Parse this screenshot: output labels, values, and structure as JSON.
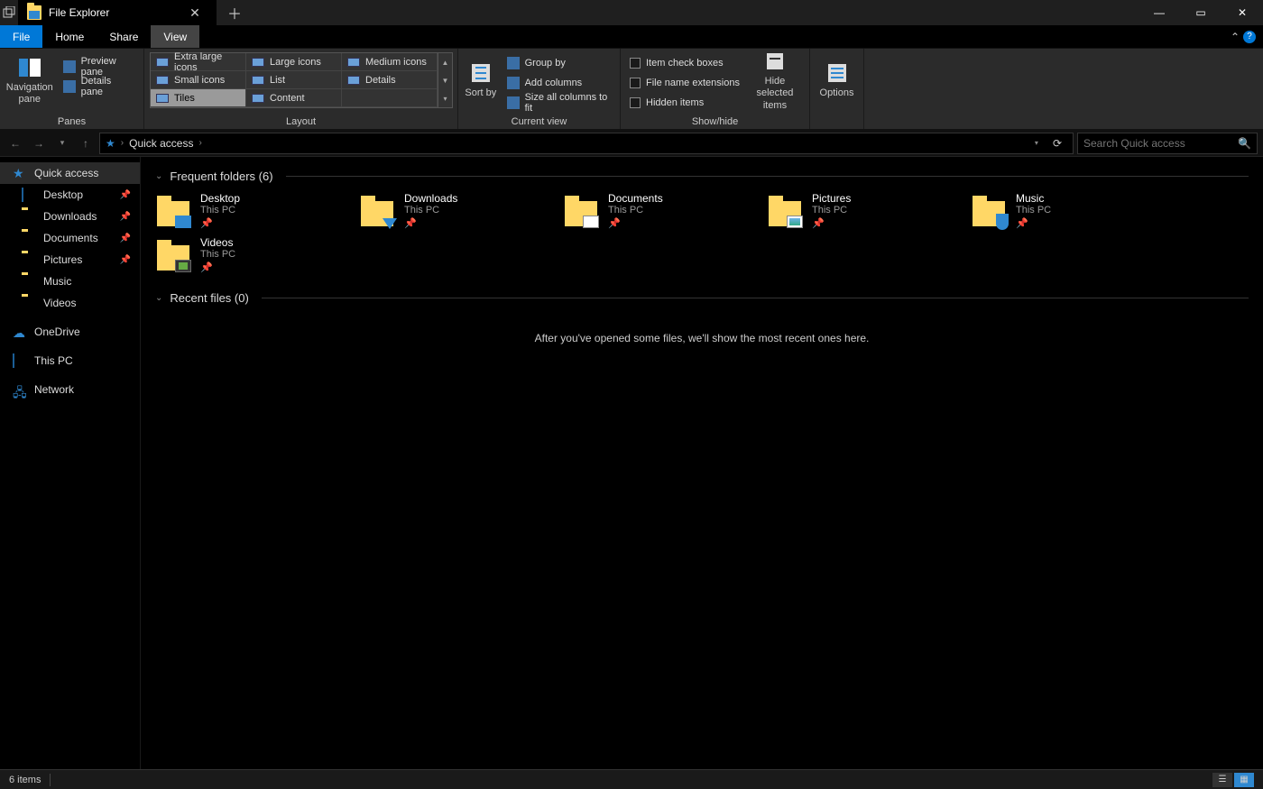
{
  "titlebar": {
    "tab_title": "File Explorer",
    "close_glyph": "✕",
    "newtab_glyph": "＋",
    "min_glyph": "—",
    "max_glyph": "▭",
    "winclose_glyph": "✕"
  },
  "menutabs": {
    "file": "File",
    "home": "Home",
    "share": "Share",
    "view": "View",
    "collapse_glyph": "⌃",
    "help_glyph": "?"
  },
  "ribbon": {
    "panes": {
      "nav": "Navigation pane",
      "preview": "Preview pane",
      "details": "Details pane",
      "label": "Panes"
    },
    "layout": {
      "items": [
        "Extra large icons",
        "Large icons",
        "Medium icons",
        "Small icons",
        "List",
        "Details",
        "Tiles",
        "Content"
      ],
      "selected_index": 6,
      "label": "Layout"
    },
    "currentview": {
      "sortby": "Sort by",
      "groupby": "Group by",
      "addcols": "Add columns",
      "sizecols": "Size all columns to fit",
      "label": "Current view"
    },
    "showhide": {
      "itemchk": "Item check boxes",
      "ext": "File name extensions",
      "hidden": "Hidden items",
      "hidesel": "Hide selected items",
      "label": "Show/hide"
    },
    "options": "Options"
  },
  "nav": {
    "crumb": "Quick access",
    "search_placeholder": "Search Quick access"
  },
  "sidebar": {
    "items": [
      {
        "label": "Quick access",
        "kind": "star",
        "selected": true,
        "top": true
      },
      {
        "label": "Desktop",
        "kind": "monitor",
        "pinned": true
      },
      {
        "label": "Downloads",
        "kind": "folder",
        "pinned": true
      },
      {
        "label": "Documents",
        "kind": "folder",
        "pinned": true
      },
      {
        "label": "Pictures",
        "kind": "folder",
        "pinned": true
      },
      {
        "label": "Music",
        "kind": "folder"
      },
      {
        "label": "Videos",
        "kind": "folder"
      },
      {
        "label": "",
        "kind": "gap"
      },
      {
        "label": "OneDrive",
        "kind": "cloud",
        "top": true
      },
      {
        "label": "",
        "kind": "gap"
      },
      {
        "label": "This PC",
        "kind": "monitor",
        "top": true
      },
      {
        "label": "",
        "kind": "gap"
      },
      {
        "label": "Network",
        "kind": "network",
        "top": true
      }
    ]
  },
  "content": {
    "frequent_header": "Frequent folders (6)",
    "frequent": [
      {
        "name": "Desktop",
        "sub": "This PC",
        "badge": "desktop"
      },
      {
        "name": "Downloads",
        "sub": "This PC",
        "badge": "dl"
      },
      {
        "name": "Documents",
        "sub": "This PC",
        "badge": "doc"
      },
      {
        "name": "Pictures",
        "sub": "This PC",
        "badge": "pic"
      },
      {
        "name": "Music",
        "sub": "This PC",
        "badge": "mus"
      },
      {
        "name": "Videos",
        "sub": "This PC",
        "badge": "vid"
      }
    ],
    "recent_header": "Recent files (0)",
    "recent_empty": "After you've opened some files, we'll show the most recent ones here."
  },
  "status": {
    "count": "6 items"
  }
}
